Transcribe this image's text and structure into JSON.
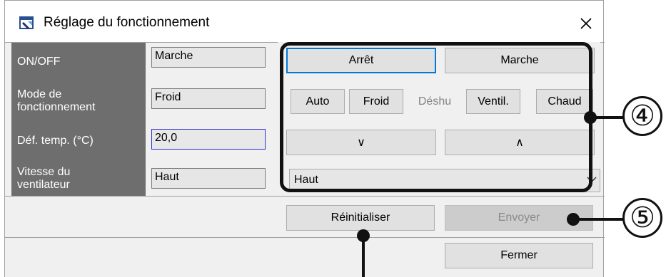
{
  "window": {
    "title": "Réglage du fonctionnement",
    "close_glyph": "✕",
    "icon": "settings-app-icon"
  },
  "rows": [
    {
      "label": "ON/OFF",
      "value": "Marche"
    },
    {
      "label": "Mode de fonctionnement",
      "label_line1": "Mode de",
      "label_line2": "fonctionnement",
      "value": "Froid"
    },
    {
      "label": "Déf. temp. (°C)",
      "value": "20,0"
    },
    {
      "label": "Vitesse du ventilateur",
      "label_line1": "Vitesse du",
      "label_line2": "ventilateur",
      "value": "Haut"
    }
  ],
  "onoff_buttons": {
    "off": "Arrêt",
    "on": "Marche"
  },
  "mode_buttons": {
    "auto": "Auto",
    "cool": "Froid",
    "dry": "Déshu",
    "fan": "Ventil.",
    "heat": "Chaud"
  },
  "temp_buttons": {
    "down": "∨",
    "up": "∧"
  },
  "fan_speed_select": {
    "selected": "Haut"
  },
  "actions": {
    "reset": "Réinitialiser",
    "send": "Envoyer",
    "close": "Fermer"
  },
  "annotations": {
    "group_controls": "④",
    "send_marker": "⑤"
  },
  "colors": {
    "label_bg": "#6e6e6e",
    "focus_border": "#0078d7",
    "active_field_border": "#2b2bd6"
  }
}
